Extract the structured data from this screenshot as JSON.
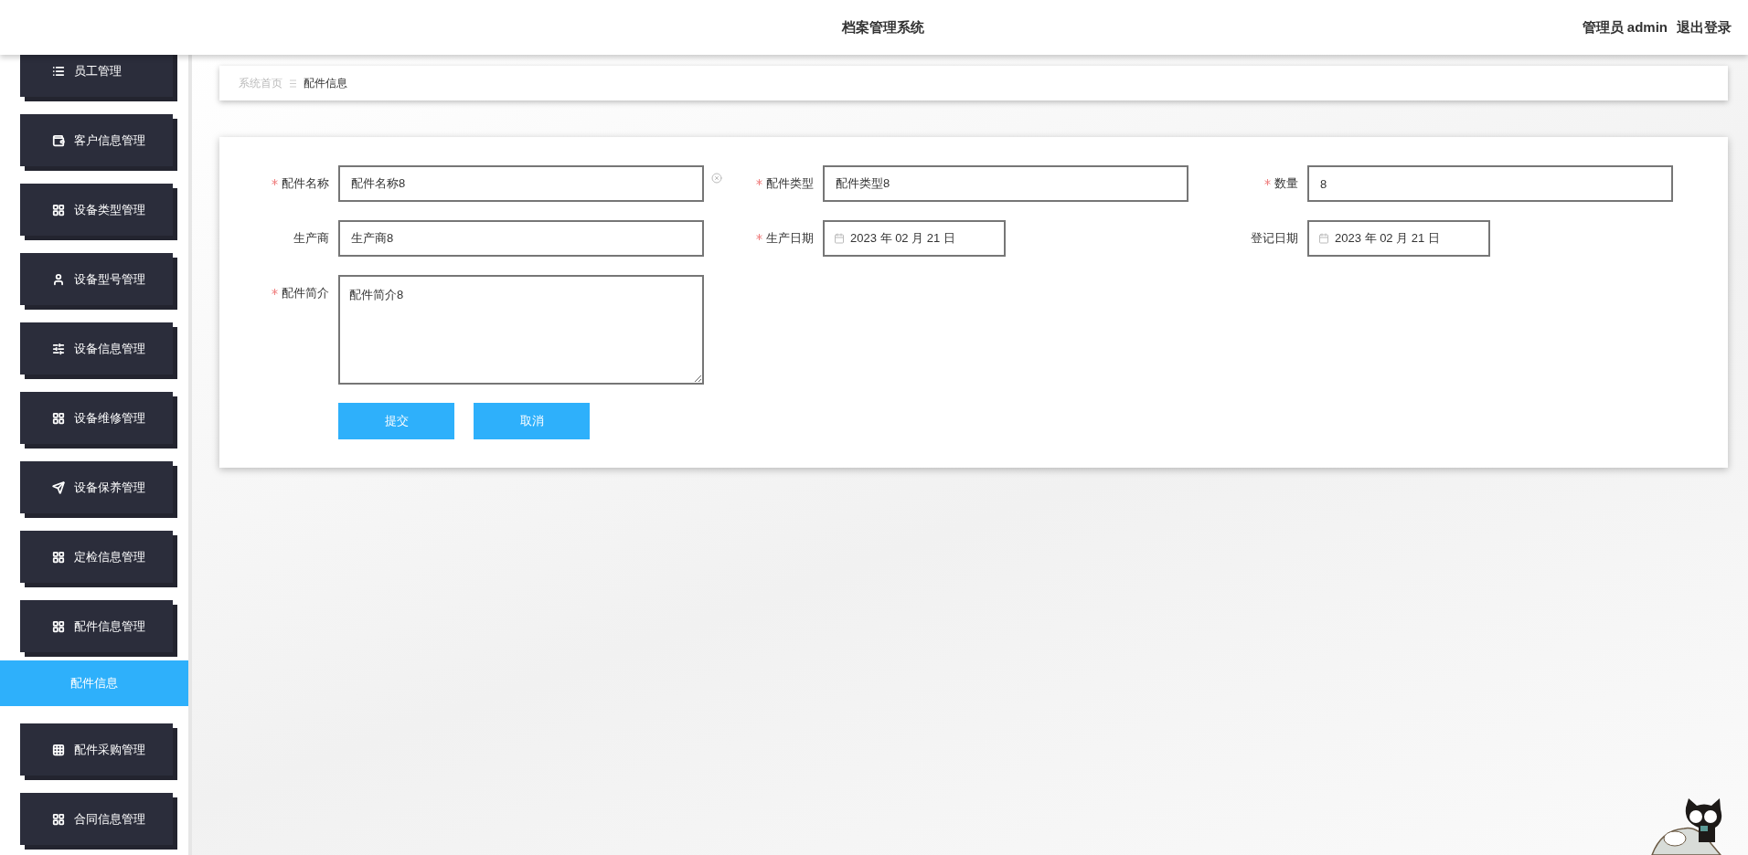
{
  "header": {
    "title": "档案管理系统",
    "user": "管理员 admin",
    "logout": "退出登录"
  },
  "sidebar": {
    "items": [
      {
        "label": "员工管理"
      },
      {
        "label": "客户信息管理"
      },
      {
        "label": "设备类型管理"
      },
      {
        "label": "设备型号管理"
      },
      {
        "label": "设备信息管理"
      },
      {
        "label": "设备维修管理"
      },
      {
        "label": "设备保养管理"
      },
      {
        "label": "定检信息管理"
      },
      {
        "label": "配件信息管理",
        "children": [
          {
            "label": "配件信息",
            "selected": true
          }
        ]
      },
      {
        "label": "配件采购管理"
      },
      {
        "label": "合同信息管理"
      }
    ]
  },
  "breadcrumb": [
    {
      "label": "系统首页",
      "current": false
    },
    {
      "label": "配件信息",
      "current": true
    }
  ],
  "form": {
    "fields": [
      {
        "kind": "text",
        "label": "配件名称",
        "required": true,
        "value": "配件名称8",
        "clearable": true
      },
      {
        "kind": "text",
        "label": "配件类型",
        "required": true,
        "value": "配件类型8",
        "clearable": false
      },
      {
        "kind": "text",
        "label": "数量",
        "required": true,
        "value": "8",
        "clearable": false
      },
      {
        "kind": "text",
        "label": "生产商",
        "required": false,
        "value": "生产商8",
        "clearable": false
      },
      {
        "kind": "date",
        "label": "生产日期",
        "required": true,
        "value": "2023 年 02 月 21 日"
      },
      {
        "kind": "date",
        "label": "登记日期",
        "required": false,
        "value": "2023 年 02 月 21 日"
      },
      {
        "kind": "textarea",
        "label": "配件简介",
        "required": true,
        "value": "配件简介8"
      }
    ],
    "buttons": [
      {
        "label": "提交"
      },
      {
        "label": "取消"
      }
    ]
  }
}
